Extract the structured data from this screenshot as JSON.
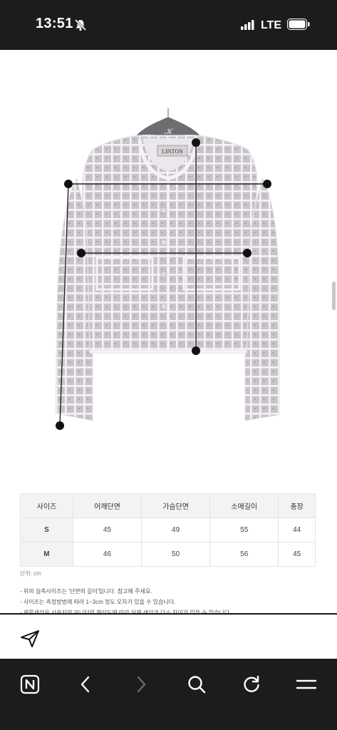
{
  "status_bar": {
    "time": "13:51",
    "network": "LTE"
  },
  "product_image": {
    "brand_label": "LINTON"
  },
  "size_table": {
    "headers": [
      "사이즈",
      "어깨단면",
      "가슴단면",
      "소매길이",
      "총장"
    ],
    "rows": [
      [
        "S",
        "45",
        "49",
        "55",
        "44"
      ],
      [
        "M",
        "46",
        "50",
        "56",
        "45"
      ]
    ]
  },
  "unit_note": "단위: cm",
  "notes": [
    "- 위의 실측사이즈는 '단면의 길이'입니다. 참고해 주세요.",
    "- 사이즈는 측정방법에 따라 1~3cm 정도 오차가 있을 수 있습니다.",
    "- 제품색상은 사용자의 모니터의 해상도에 따라 실제 색상과 다소 차이가 있을 수 있습니다."
  ],
  "icons": {
    "silent": "bell-slash-icon",
    "signal": "signal-icon",
    "battery": "battery-icon",
    "share": "send-icon",
    "home": "naver-n-icon",
    "back": "chevron-left-icon",
    "forward": "chevron-right-icon",
    "search": "search-icon",
    "refresh": "refresh-icon",
    "menu": "menu-icon"
  }
}
